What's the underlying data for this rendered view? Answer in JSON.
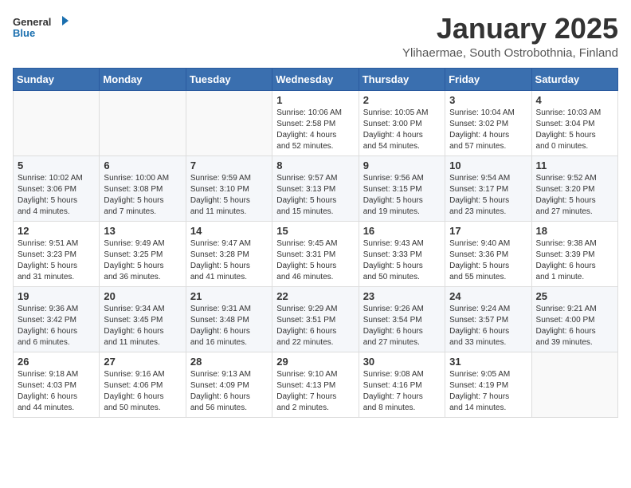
{
  "header": {
    "logo_general": "General",
    "logo_blue": "Blue",
    "month": "January 2025",
    "location": "Ylihaermae, South Ostrobothnia, Finland"
  },
  "days_of_week": [
    "Sunday",
    "Monday",
    "Tuesday",
    "Wednesday",
    "Thursday",
    "Friday",
    "Saturday"
  ],
  "weeks": [
    [
      {
        "day": "",
        "info": ""
      },
      {
        "day": "",
        "info": ""
      },
      {
        "day": "",
        "info": ""
      },
      {
        "day": "1",
        "info": "Sunrise: 10:06 AM\nSunset: 2:58 PM\nDaylight: 4 hours\nand 52 minutes."
      },
      {
        "day": "2",
        "info": "Sunrise: 10:05 AM\nSunset: 3:00 PM\nDaylight: 4 hours\nand 54 minutes."
      },
      {
        "day": "3",
        "info": "Sunrise: 10:04 AM\nSunset: 3:02 PM\nDaylight: 4 hours\nand 57 minutes."
      },
      {
        "day": "4",
        "info": "Sunrise: 10:03 AM\nSunset: 3:04 PM\nDaylight: 5 hours\nand 0 minutes."
      }
    ],
    [
      {
        "day": "5",
        "info": "Sunrise: 10:02 AM\nSunset: 3:06 PM\nDaylight: 5 hours\nand 4 minutes."
      },
      {
        "day": "6",
        "info": "Sunrise: 10:00 AM\nSunset: 3:08 PM\nDaylight: 5 hours\nand 7 minutes."
      },
      {
        "day": "7",
        "info": "Sunrise: 9:59 AM\nSunset: 3:10 PM\nDaylight: 5 hours\nand 11 minutes."
      },
      {
        "day": "8",
        "info": "Sunrise: 9:57 AM\nSunset: 3:13 PM\nDaylight: 5 hours\nand 15 minutes."
      },
      {
        "day": "9",
        "info": "Sunrise: 9:56 AM\nSunset: 3:15 PM\nDaylight: 5 hours\nand 19 minutes."
      },
      {
        "day": "10",
        "info": "Sunrise: 9:54 AM\nSunset: 3:17 PM\nDaylight: 5 hours\nand 23 minutes."
      },
      {
        "day": "11",
        "info": "Sunrise: 9:52 AM\nSunset: 3:20 PM\nDaylight: 5 hours\nand 27 minutes."
      }
    ],
    [
      {
        "day": "12",
        "info": "Sunrise: 9:51 AM\nSunset: 3:23 PM\nDaylight: 5 hours\nand 31 minutes."
      },
      {
        "day": "13",
        "info": "Sunrise: 9:49 AM\nSunset: 3:25 PM\nDaylight: 5 hours\nand 36 minutes."
      },
      {
        "day": "14",
        "info": "Sunrise: 9:47 AM\nSunset: 3:28 PM\nDaylight: 5 hours\nand 41 minutes."
      },
      {
        "day": "15",
        "info": "Sunrise: 9:45 AM\nSunset: 3:31 PM\nDaylight: 5 hours\nand 46 minutes."
      },
      {
        "day": "16",
        "info": "Sunrise: 9:43 AM\nSunset: 3:33 PM\nDaylight: 5 hours\nand 50 minutes."
      },
      {
        "day": "17",
        "info": "Sunrise: 9:40 AM\nSunset: 3:36 PM\nDaylight: 5 hours\nand 55 minutes."
      },
      {
        "day": "18",
        "info": "Sunrise: 9:38 AM\nSunset: 3:39 PM\nDaylight: 6 hours\nand 1 minute."
      }
    ],
    [
      {
        "day": "19",
        "info": "Sunrise: 9:36 AM\nSunset: 3:42 PM\nDaylight: 6 hours\nand 6 minutes."
      },
      {
        "day": "20",
        "info": "Sunrise: 9:34 AM\nSunset: 3:45 PM\nDaylight: 6 hours\nand 11 minutes."
      },
      {
        "day": "21",
        "info": "Sunrise: 9:31 AM\nSunset: 3:48 PM\nDaylight: 6 hours\nand 16 minutes."
      },
      {
        "day": "22",
        "info": "Sunrise: 9:29 AM\nSunset: 3:51 PM\nDaylight: 6 hours\nand 22 minutes."
      },
      {
        "day": "23",
        "info": "Sunrise: 9:26 AM\nSunset: 3:54 PM\nDaylight: 6 hours\nand 27 minutes."
      },
      {
        "day": "24",
        "info": "Sunrise: 9:24 AM\nSunset: 3:57 PM\nDaylight: 6 hours\nand 33 minutes."
      },
      {
        "day": "25",
        "info": "Sunrise: 9:21 AM\nSunset: 4:00 PM\nDaylight: 6 hours\nand 39 minutes."
      }
    ],
    [
      {
        "day": "26",
        "info": "Sunrise: 9:18 AM\nSunset: 4:03 PM\nDaylight: 6 hours\nand 44 minutes."
      },
      {
        "day": "27",
        "info": "Sunrise: 9:16 AM\nSunset: 4:06 PM\nDaylight: 6 hours\nand 50 minutes."
      },
      {
        "day": "28",
        "info": "Sunrise: 9:13 AM\nSunset: 4:09 PM\nDaylight: 6 hours\nand 56 minutes."
      },
      {
        "day": "29",
        "info": "Sunrise: 9:10 AM\nSunset: 4:13 PM\nDaylight: 7 hours\nand 2 minutes."
      },
      {
        "day": "30",
        "info": "Sunrise: 9:08 AM\nSunset: 4:16 PM\nDaylight: 7 hours\nand 8 minutes."
      },
      {
        "day": "31",
        "info": "Sunrise: 9:05 AM\nSunset: 4:19 PM\nDaylight: 7 hours\nand 14 minutes."
      },
      {
        "day": "",
        "info": ""
      }
    ]
  ]
}
